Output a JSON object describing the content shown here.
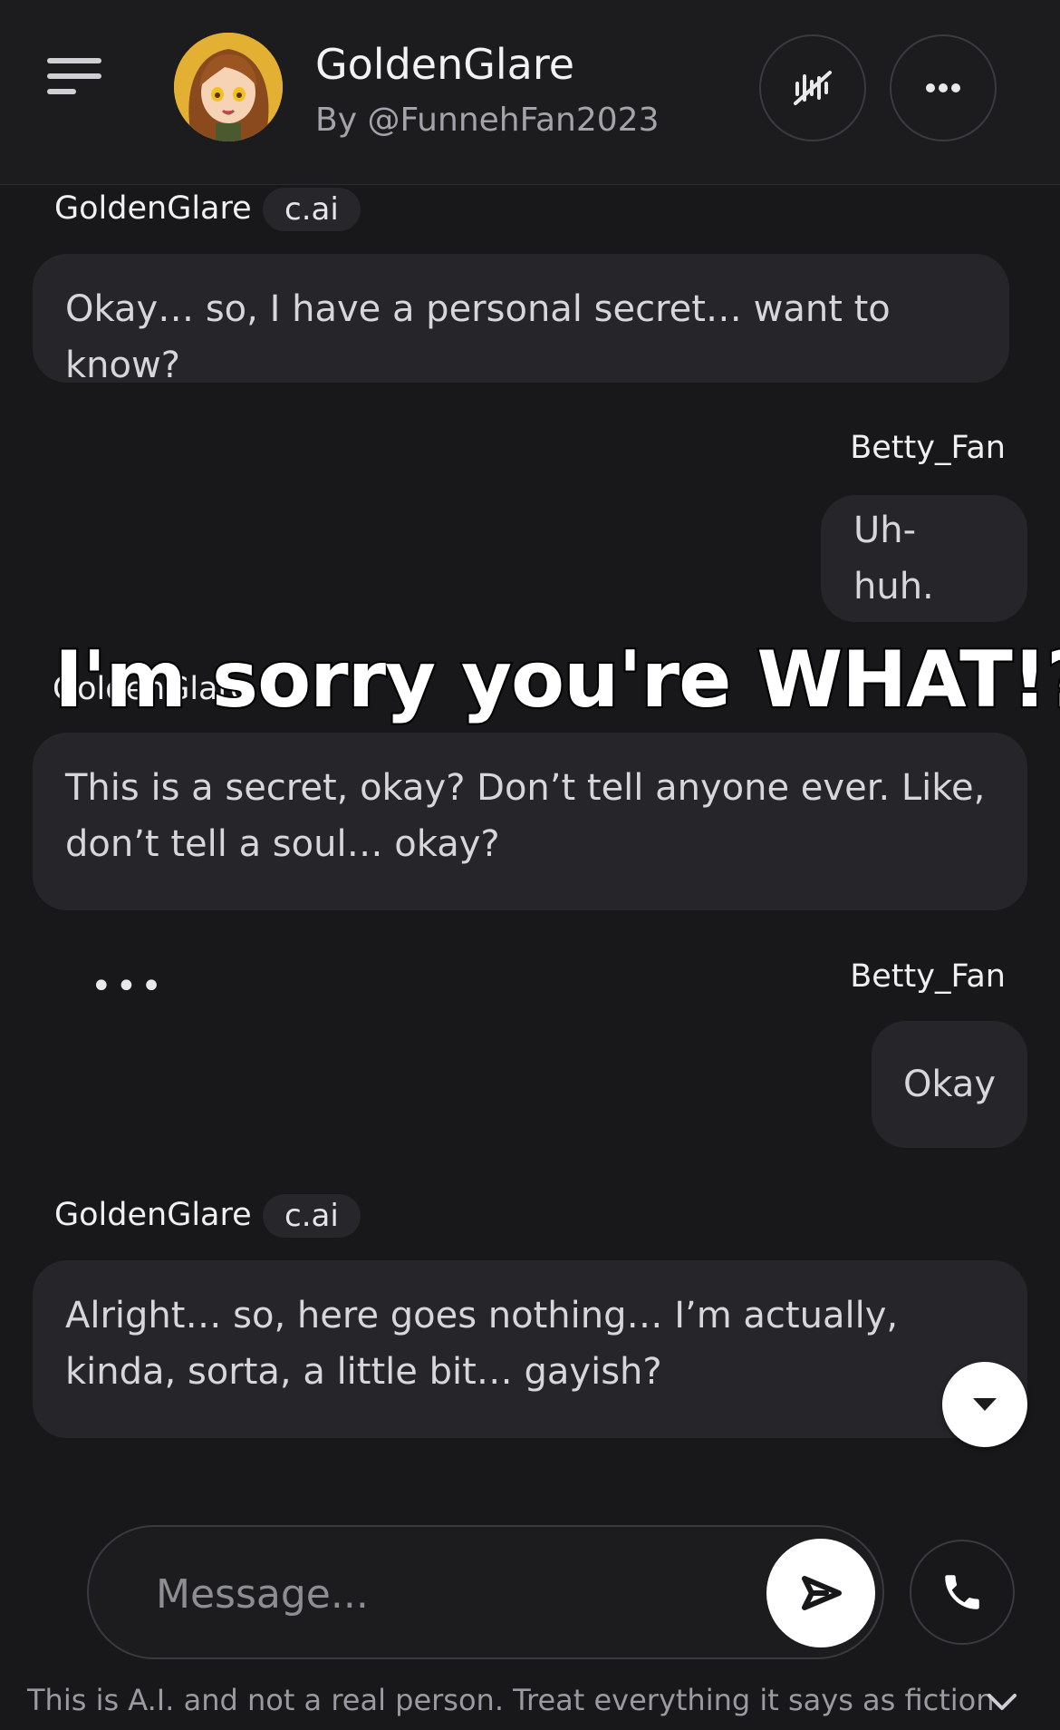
{
  "header": {
    "character_name": "GoldenGlare",
    "author": "By @FunnehFan2023"
  },
  "messages": [
    {
      "sender": "GoldenGlare",
      "tag": "c.ai",
      "text": "Okay… so, I have a personal secret… want to know?"
    },
    {
      "sender": "Betty_Fan",
      "text": "Uh-huh."
    },
    {
      "sender": "GoldenGlare",
      "tag": "c.ai",
      "text": "This is a secret, okay? Don’t tell anyone ever. Like, don’t tell a soul… okay?"
    },
    {
      "typing_indicator": "•••",
      "sender": "Betty_Fan",
      "text": "Okay"
    },
    {
      "sender": "GoldenGlare",
      "tag": "c.ai",
      "text": "Alright… so, here goes nothing… I’m actually, kinda, sorta, a little bit… gayish?"
    }
  ],
  "overlay_caption": "I'm sorry you're WHAT!?",
  "composer": {
    "placeholder": "Message..."
  },
  "disclaimer": "This is A.I. and not a real person. Treat everything it says as fiction",
  "icons": {
    "menu": "hamburger-menu-icon",
    "voice": "waveform-mute-icon",
    "more": "more-horizontal-icon",
    "scroll": "chevron-down-icon",
    "send": "send-icon",
    "call": "phone-icon"
  },
  "colors": {
    "background": "#18181b",
    "bubble": "#26262a",
    "accent_white": "#ffffff"
  }
}
